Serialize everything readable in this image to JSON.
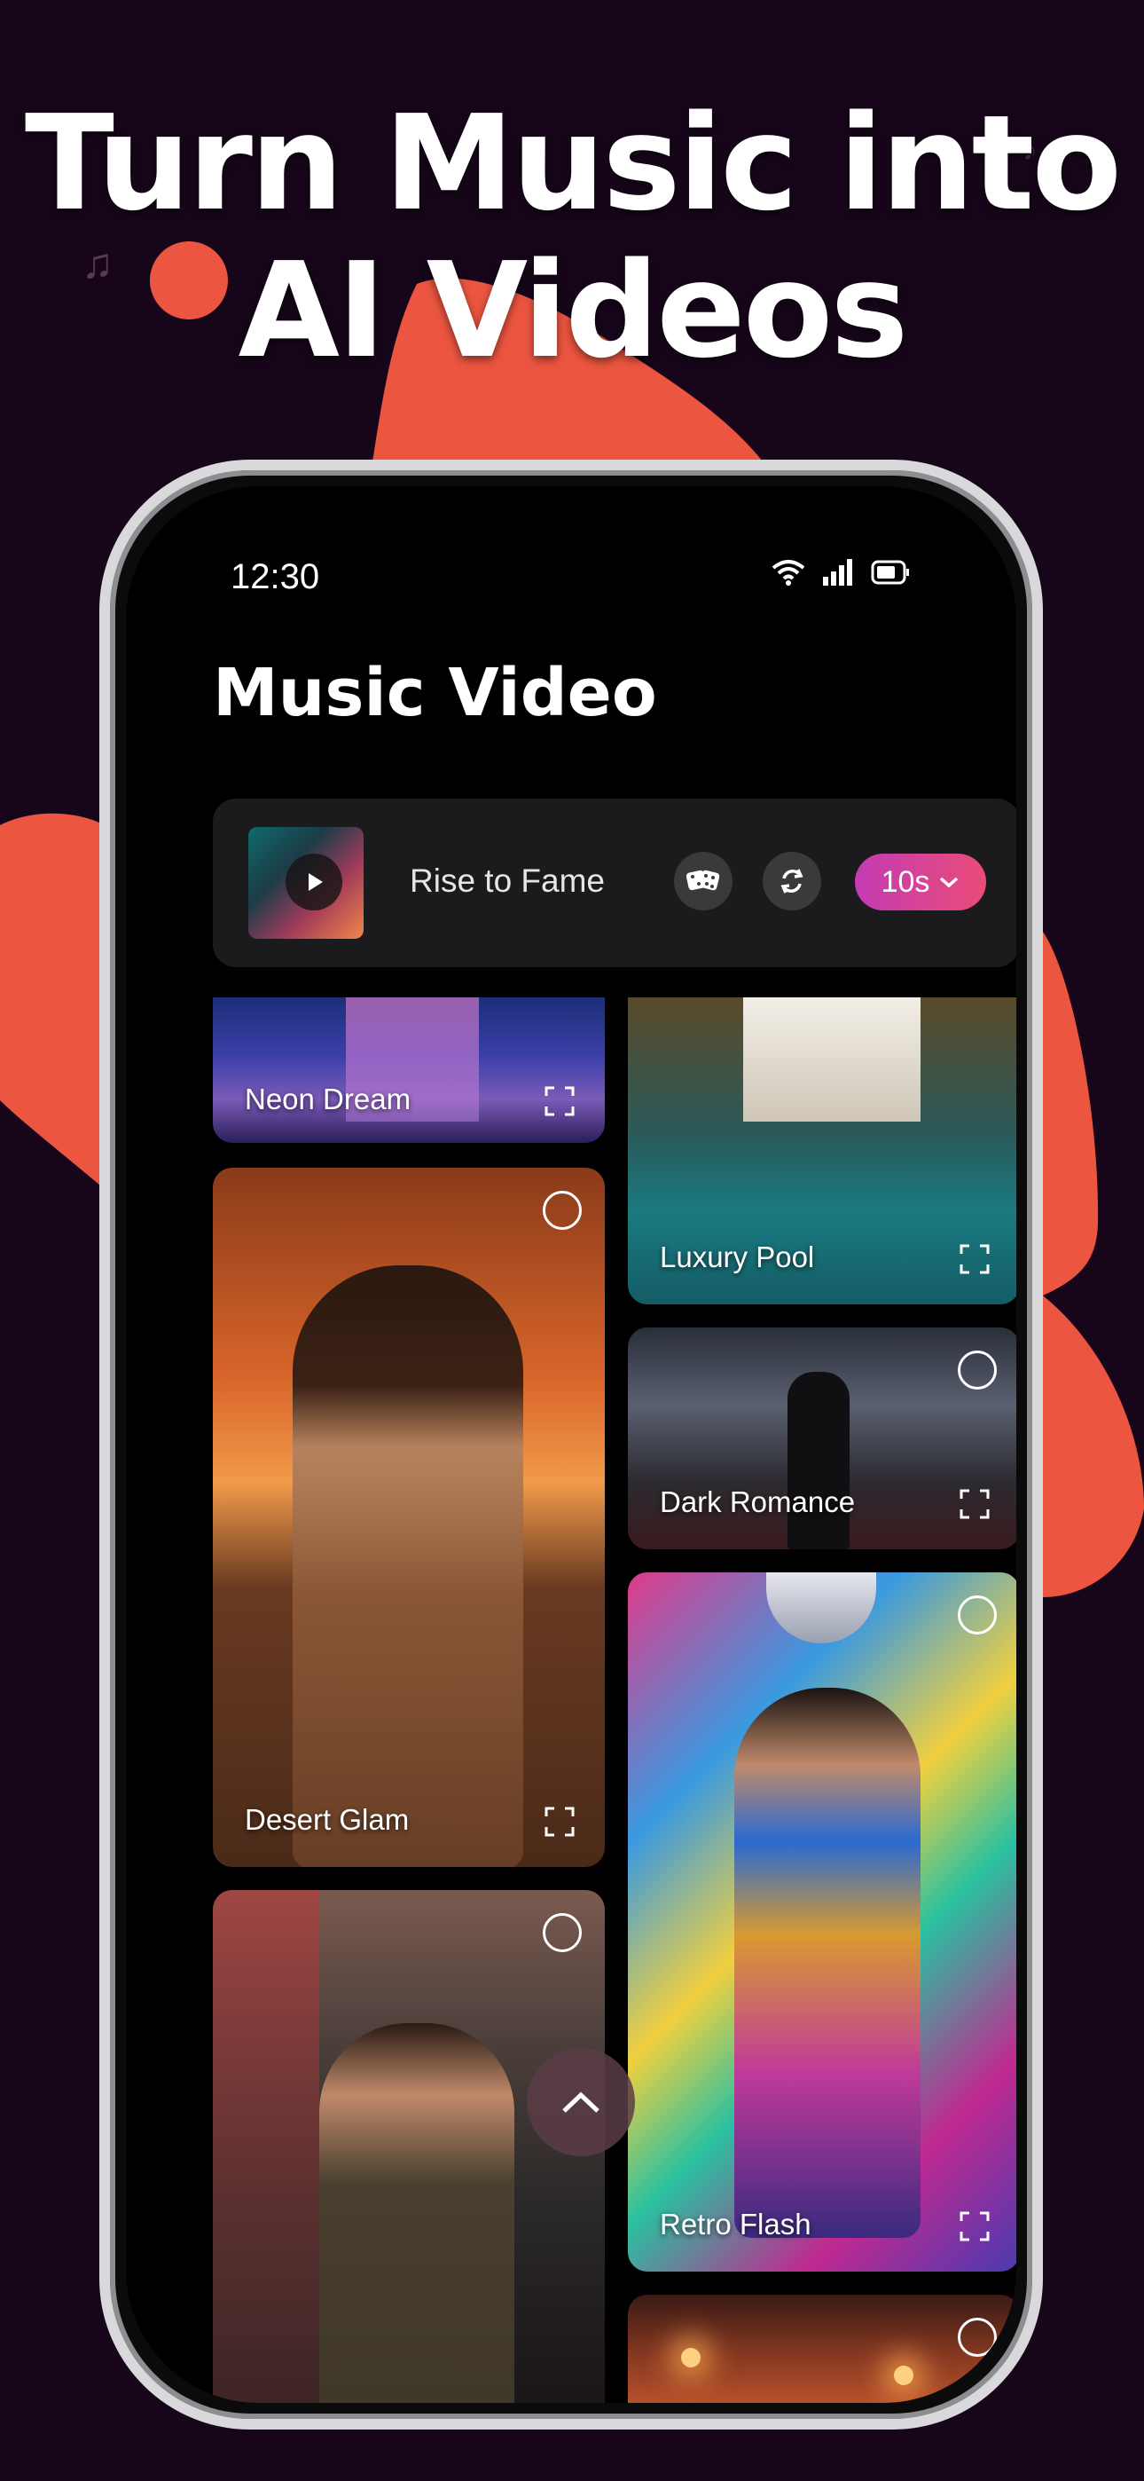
{
  "promo": {
    "headline_line1": "Turn Music into",
    "headline_line2": "AI Videos",
    "accent_color": "#ec5640",
    "background_color": "#17061a"
  },
  "status_bar": {
    "time": "12:30",
    "icons": [
      "wifi-icon",
      "signal-icon",
      "battery-icon"
    ]
  },
  "page": {
    "title": "Music Video"
  },
  "player": {
    "track_title": "Rise to Fame",
    "duration_label": "10s",
    "icons": [
      "play-icon",
      "dice-icon",
      "refresh-icon",
      "chevron-down-icon"
    ]
  },
  "cards": [
    {
      "label": "Neon Dream",
      "selectable": false
    },
    {
      "label": "Luxury Pool",
      "selectable": false
    },
    {
      "label": "Desert Glam",
      "selectable": true
    },
    {
      "label": "Dark Romance",
      "selectable": true
    },
    {
      "label": "",
      "selectable": true
    },
    {
      "label": "Retro Flash",
      "selectable": true
    },
    {
      "label": "",
      "selectable": true
    }
  ],
  "scroll_top_icon": "chevron-up-icon"
}
